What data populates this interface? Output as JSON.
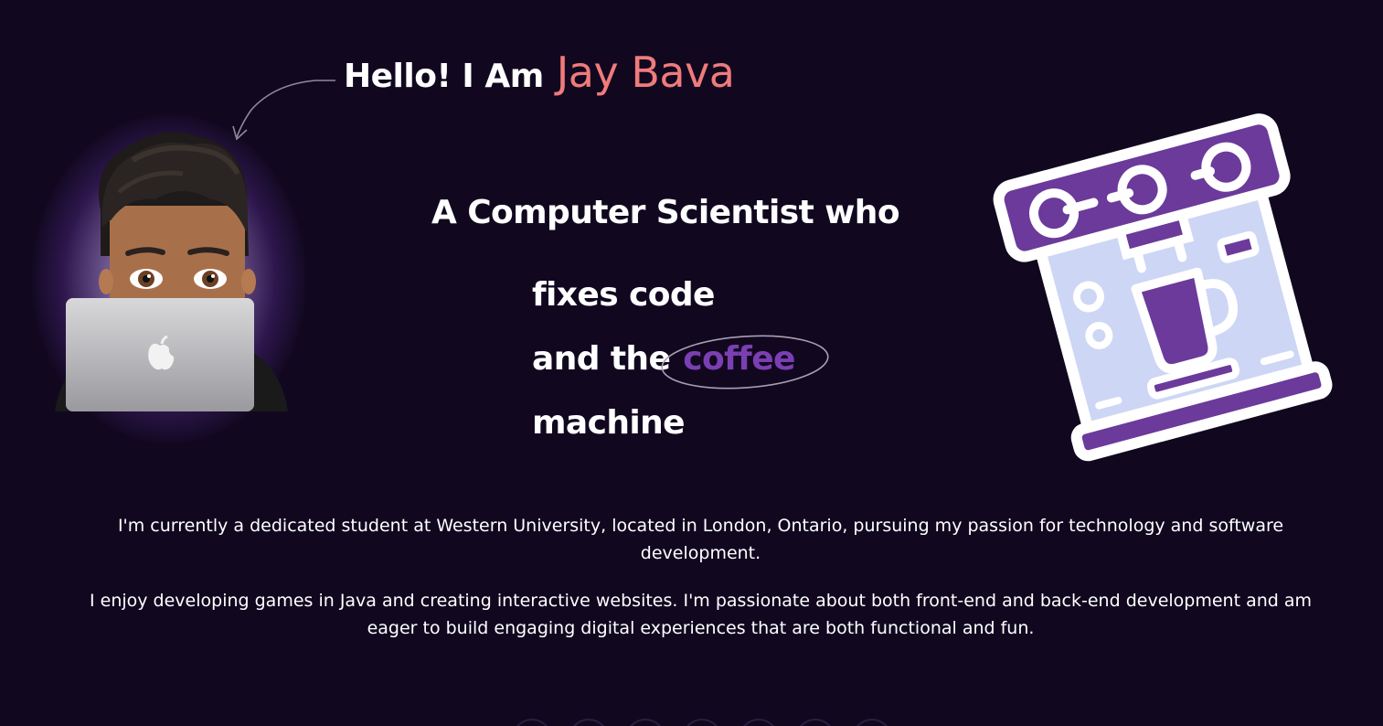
{
  "hero": {
    "greeting_prefix": "Hello! I Am",
    "name": "Jay Bava",
    "tagline": "A Computer Scientist who",
    "line1": "fixes code",
    "line2_prefix": "and the",
    "line2_highlight": "coffee",
    "line3": "machine"
  },
  "about": {
    "paragraph1": "I'm currently a dedicated student at Western University, located in London, Ontario, pursuing my passion for technology and software development.",
    "paragraph2": "I enjoy developing games in Java and creating interactive websites. I'm passionate about both front-end and back-end development and am eager to build engaging digital experiences that are both functional and fun."
  },
  "icons": {
    "avatar": "memoji-laptop-avatar",
    "arrow": "curved-arrow-icon",
    "machine": "coffee-machine-icon"
  },
  "colors": {
    "background": "#110820",
    "name_accent": "#f07b7b",
    "coffee_accent": "#7b3fb3",
    "machine_purple": "#6b3a9b",
    "machine_light": "#cdd6f4"
  }
}
